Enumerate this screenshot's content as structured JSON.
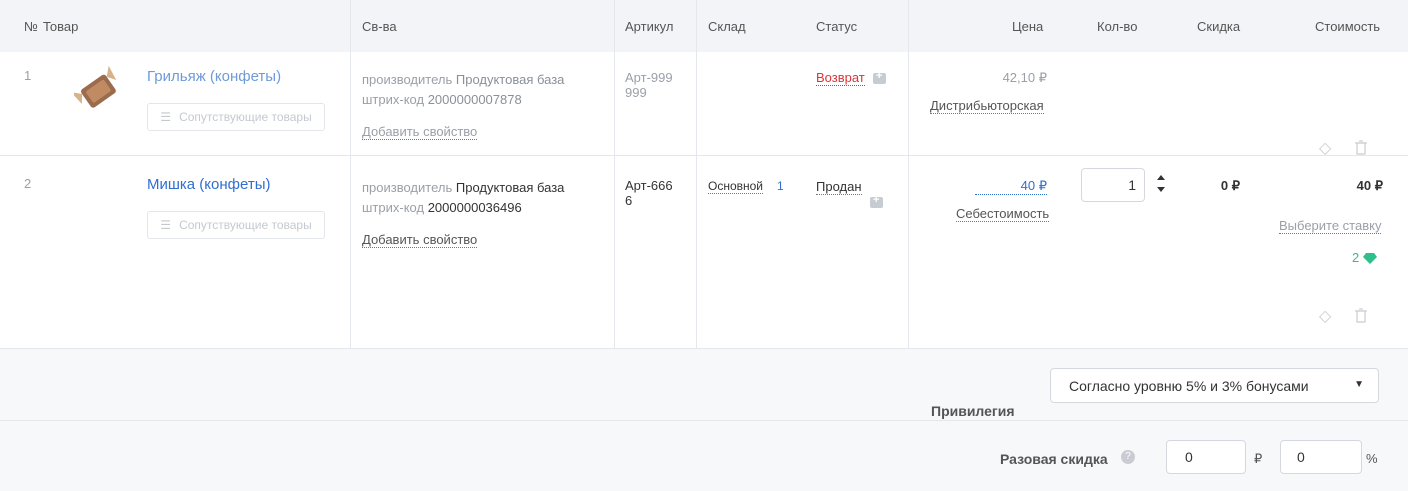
{
  "header": {
    "num": "№",
    "product": "Товар",
    "props": "Св-ва",
    "article": "Артикул",
    "warehouse": "Склад",
    "status": "Статус",
    "price": "Цена",
    "qty": "Кол-во",
    "discount": "Скидка",
    "cost": "Стоимость"
  },
  "rows": [
    {
      "num": "1",
      "name": "Грильяж (конфеты)",
      "related_btn": "Сопутствующие товары",
      "props": [
        {
          "key": "производитель",
          "value": "Продуктовая база"
        },
        {
          "key": "штрих-код",
          "value": "2000000007878"
        }
      ],
      "add_prop": "Добавить свойство",
      "article": [
        "Арт-999",
        "999"
      ],
      "warehouse": "",
      "status": "Возврат",
      "price": "42,10 ₽",
      "price_type": "Дистрибьюторская"
    },
    {
      "num": "2",
      "name": "Мишка (конфеты)",
      "related_btn": "Сопутствующие товары",
      "props": [
        {
          "key": "производитель",
          "value": "Продуктовая база"
        },
        {
          "key": "штрих-код",
          "value": "2000000036496"
        }
      ],
      "add_prop": "Добавить свойство",
      "article": [
        "Арт-666",
        "6"
      ],
      "warehouse": "Основной",
      "warehouse_count": "1",
      "status": "Продан",
      "price": "40 ₽",
      "price_type": "Себестоимость",
      "qty": "1",
      "discount": "0 ₽",
      "cost": "40 ₽",
      "rate_link": "Выберите ставку",
      "bonus": "2"
    }
  ],
  "footer": {
    "privilege_label": "Привилегия",
    "privilege_value": "Согласно уровню 5% и 3% бонусами",
    "one_time_label": "Разовая скидка",
    "discount_rub": "0",
    "rub_sign": "₽",
    "discount_pct": "0",
    "pct_sign": "%"
  },
  "colors": {
    "accent": "#2f6fd1",
    "return_red": "#d9343a",
    "bonus_green": "#2fbf8a"
  }
}
